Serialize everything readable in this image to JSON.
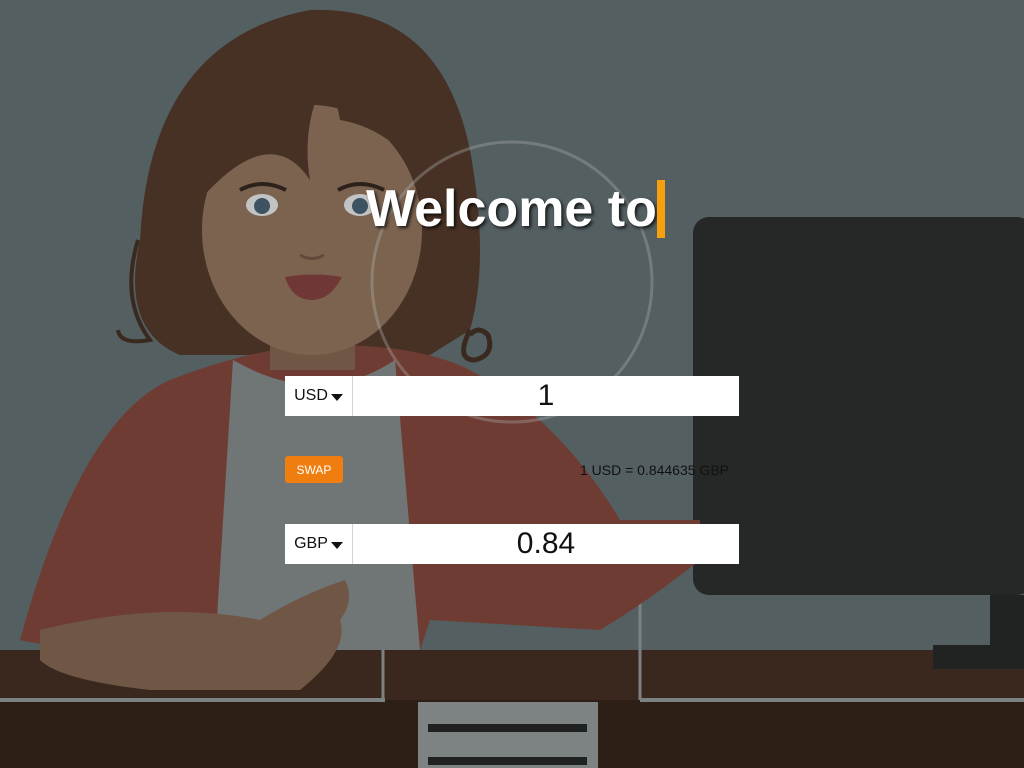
{
  "hero": {
    "title": "Welcome to"
  },
  "converter": {
    "from": {
      "currency": "USD",
      "amount": "1"
    },
    "to": {
      "currency": "GBP",
      "amount": "0.84"
    },
    "swap_label": "SWAP",
    "rate_text": "1 USD = 0.844635 GBP"
  },
  "colors": {
    "accent": "#f07d10",
    "caret": "#f5a00c",
    "background": "#5a6568"
  }
}
